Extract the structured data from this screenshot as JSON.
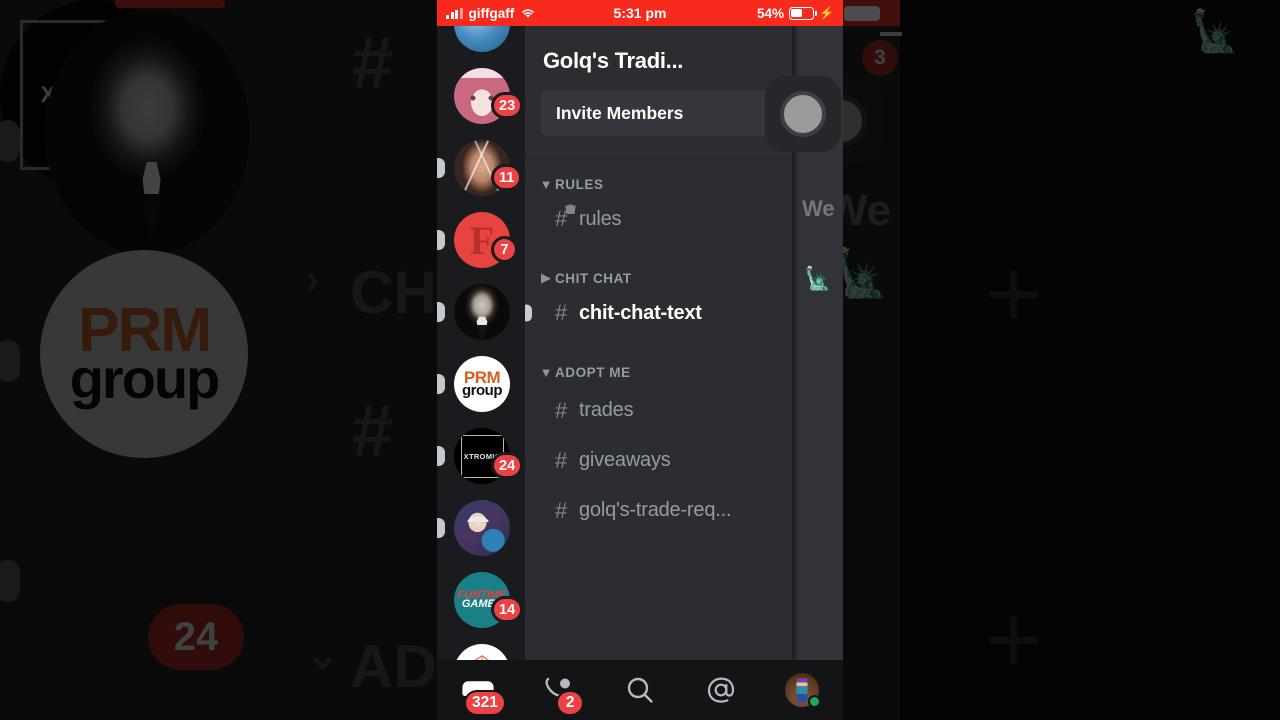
{
  "status_bar": {
    "carrier": "giffgaff",
    "signal_icon": "signal-bars-icon",
    "wifi_icon": "wifi-icon",
    "time": "5:31 pm",
    "battery_percent": "54%",
    "battery_icon": "battery-icon",
    "charging_icon": "lightning-bolt-icon",
    "background_color": "#f8291d"
  },
  "server_rail": {
    "servers": [
      {
        "name": "earth-server",
        "badge": "",
        "unread": false
      },
      {
        "name": "anime-girl-server",
        "badge": "23",
        "unread": false
      },
      {
        "name": "face-photo-server",
        "badge": "11",
        "unread": true
      },
      {
        "name": "f-logo-server",
        "badge": "7",
        "unread": true
      },
      {
        "name": "portrait-man-server",
        "badge": "",
        "unread": true
      },
      {
        "name": "prm-group-server",
        "badge": "",
        "unread": true,
        "label_top": "PRM",
        "label_bottom": "group"
      },
      {
        "name": "xtromic-server",
        "badge": "24",
        "unread": true,
        "label": "XTROMIC"
      },
      {
        "name": "scientist-server",
        "badge": "",
        "unread": true
      },
      {
        "name": "funtime-games-server",
        "badge": "14",
        "unread": false,
        "label_top": "FUNTIME",
        "label_bottom": "GAMES"
      },
      {
        "name": "d20-dice-server",
        "badge": "",
        "unread": true
      }
    ]
  },
  "server_panel": {
    "title": "Golq's Tradi...",
    "overflow_icon": "more-options-icon",
    "invite": {
      "label": "Invite Members",
      "icon": "add-person-icon"
    },
    "categories": [
      {
        "name": "RULES",
        "expanded": true,
        "chevron": "chevron-down-icon",
        "add_icon": "plus-icon",
        "channels": [
          {
            "name": "rules",
            "hash": "#",
            "locked": true,
            "active": false,
            "unread": false
          }
        ]
      },
      {
        "name": "CHIT CHAT",
        "expanded": false,
        "chevron": "chevron-right-icon",
        "add_icon": "plus-icon",
        "channels": [
          {
            "name": "chit-chat-text",
            "hash": "#",
            "locked": false,
            "active": true,
            "unread": true
          }
        ]
      },
      {
        "name": "ADOPT ME",
        "expanded": true,
        "chevron": "chevron-down-icon",
        "add_icon": "plus-icon",
        "channels": [
          {
            "name": "trades",
            "hash": "#",
            "locked": false,
            "active": false,
            "unread": false
          },
          {
            "name": "giveaways",
            "hash": "#",
            "locked": false,
            "active": false,
            "unread": false
          },
          {
            "name": "golq's-trade-req...",
            "hash": "#",
            "locked": false,
            "active": false,
            "unread": false
          }
        ]
      }
    ]
  },
  "chat_sliver": {
    "text": "We"
  },
  "bottom_nav": {
    "items": [
      {
        "name": "servers-tab",
        "icon": "controller-icon",
        "badge": "321"
      },
      {
        "name": "messages-tab",
        "icon": "phone-icon",
        "badge": "2"
      },
      {
        "name": "search-tab",
        "icon": "search-icon",
        "badge": ""
      },
      {
        "name": "mentions-tab",
        "icon": "at-mention-icon",
        "badge": ""
      },
      {
        "name": "profile-tab",
        "icon": "user-avatar-icon",
        "badge": "",
        "status": "online"
      }
    ]
  },
  "overlay": {
    "touch_indicator": "assistive-touch-icon"
  },
  "background": {
    "prm_top": "PRM",
    "prm_bottom": "group",
    "xtromic": "XTROMIC",
    "badge_24": "24",
    "badge_3": "3",
    "we_text": "We",
    "ch_text": "CH",
    "ad_text": "AD",
    "hash": "#",
    "plus": "+"
  },
  "colors": {
    "accent_red": "#ed4245",
    "status_red": "#f8291d",
    "panel_bg": "#2b2d31",
    "rail_bg": "#1a1b1e",
    "nav_bg": "#131416",
    "online_green": "#23a559",
    "text_muted": "#949ba4"
  }
}
